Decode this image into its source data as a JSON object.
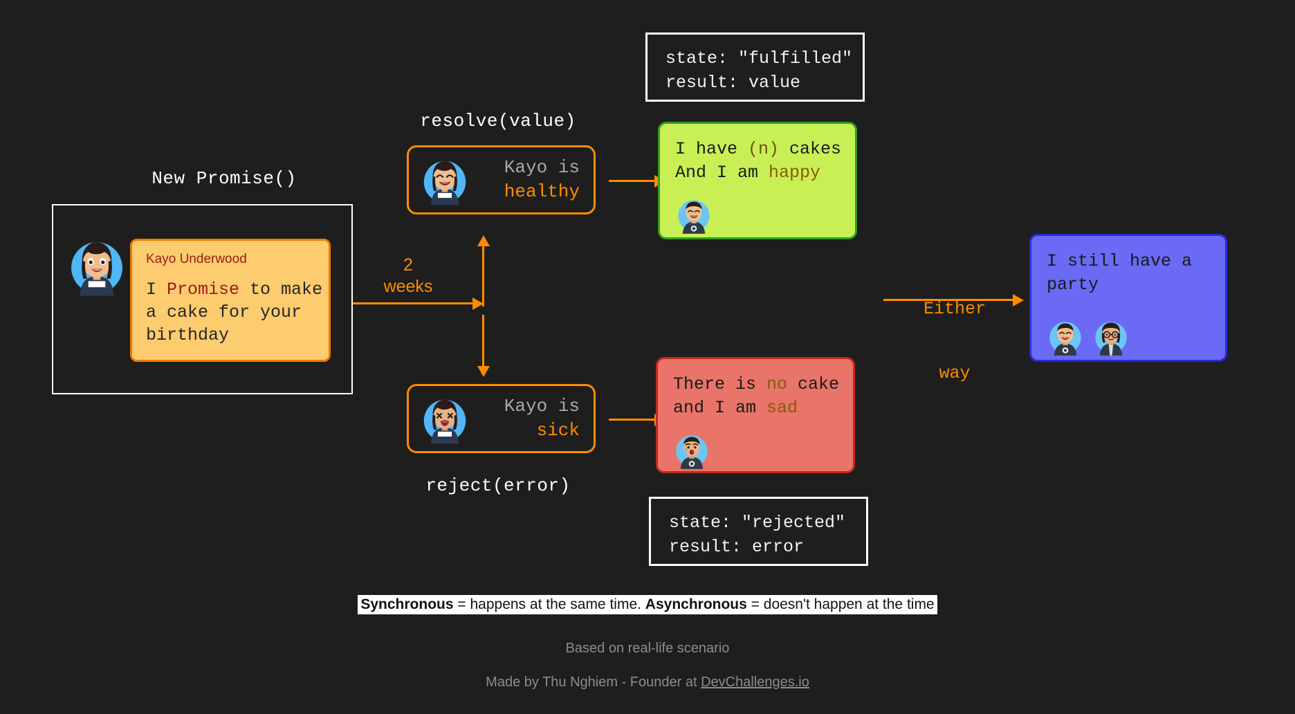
{
  "colors": {
    "background": "#1e1e1e",
    "accent_orange": "#ff8c00",
    "card_orange_bg": "#fdcc6f",
    "card_orange_border": "#f07b00",
    "green_bg": "#c8f055",
    "green_border": "#2f9e1f",
    "red_bg": "#e8746a",
    "red_border": "#c02a1c",
    "purple_bg": "#6a6af5",
    "purple_border": "#2a2ae0",
    "white": "#ffffff",
    "muted_grey": "#8c8c8c",
    "dark_red_text": "#9b1c14"
  },
  "promise": {
    "title": "New Promise()",
    "card": {
      "author": "Kayo Underwood",
      "line1_pre": "I ",
      "line1_highlight": "Promise",
      "line1_post": " to make",
      "line2": "a cake for your",
      "line3": "birthday"
    }
  },
  "timer_arrow": {
    "label_line1": "2",
    "label_line2": "weeks"
  },
  "resolve": {
    "label": "resolve(value)",
    "status": {
      "line1": "Kayo is",
      "accent": "healthy"
    },
    "state_box": {
      "line1": "state: \"fulfilled\"",
      "line2": "result: value"
    },
    "result": {
      "line1_pre": "I have ",
      "line1_highlight": "(n)",
      "line1_post": " cakes",
      "line2_pre": "And I am ",
      "line2_highlight": "happy"
    }
  },
  "reject": {
    "label": "reject(error)",
    "status": {
      "line1": "Kayo is",
      "accent": "sick"
    },
    "state_box": {
      "line1": "state: \"rejected\"",
      "line2": "result: error"
    },
    "result": {
      "line1_pre": "There is ",
      "line1_highlight": "no",
      "line1_post": " cake",
      "line2_pre": "and I am ",
      "line2_highlight": "sad"
    }
  },
  "either": {
    "label_line1": "Either",
    "label_line2": "way",
    "result": {
      "line1": "I still have a",
      "line2": "party"
    }
  },
  "footer": {
    "note_bold_1": "Synchronous",
    "note_mid": " = happens at the same time. ",
    "note_bold_2": "Asynchronous",
    "note_end": " = doesn't happen at the time",
    "subtitle": "Based on real-life scenario",
    "credit_prefix": "Made by Thu Nghiem - Founder at ",
    "credit_link": "DevChallenges.io"
  }
}
